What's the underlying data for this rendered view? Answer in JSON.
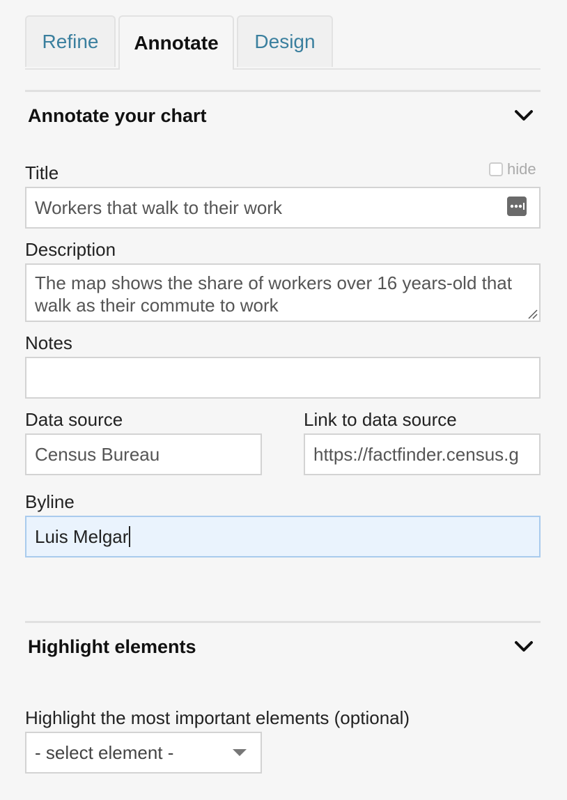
{
  "tabs": [
    {
      "label": "Refine",
      "active": false
    },
    {
      "label": "Annotate",
      "active": true
    },
    {
      "label": "Design",
      "active": false
    }
  ],
  "annotate_section": {
    "title": "Annotate your chart",
    "hide_label": "hide",
    "fields": {
      "title": {
        "label": "Title",
        "value": "Workers that walk to their work"
      },
      "description": {
        "label": "Description",
        "value": "The map shows the share of workers over 16 years-old that walk as their commute to work"
      },
      "notes": {
        "label": "Notes",
        "value": ""
      },
      "data_source": {
        "label": "Data source",
        "value": "Census Bureau"
      },
      "link_to_data_source": {
        "label": "Link to data source",
        "value": "https://factfinder.census.g"
      },
      "byline": {
        "label": "Byline",
        "value": "Luis Melgar"
      }
    }
  },
  "highlight_section": {
    "title": "Highlight elements",
    "instruction": "Highlight the most important elements (optional)",
    "select_value": "- select element -"
  },
  "colors": {
    "tab_link": "#3a7f9e",
    "focused_field_bg": "#eaf3fd"
  }
}
